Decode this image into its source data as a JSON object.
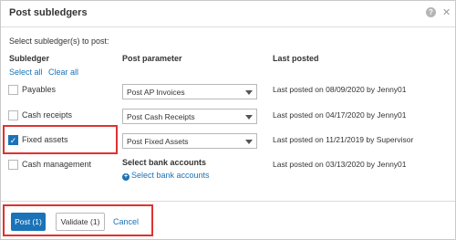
{
  "dialog": {
    "title": "Post subledgers",
    "help_icon": "question-icon",
    "close_icon": "close-icon"
  },
  "instruction": "Select subledger(s) to post:",
  "columns": {
    "subledger": "Subledger",
    "post_parameter": "Post parameter",
    "last_posted": "Last posted"
  },
  "links": {
    "select_all": "Select all",
    "clear_all": "Clear all"
  },
  "rows": [
    {
      "label": "Payables",
      "checked": false,
      "parameter": "Post AP Invoices",
      "last_posted": "Last posted on 08/09/2020 by Jenny01"
    },
    {
      "label": "Cash receipts",
      "checked": false,
      "parameter": "Post Cash Receipts",
      "last_posted": "Last posted on 04/17/2020 by Jenny01"
    },
    {
      "label": "Fixed assets",
      "checked": true,
      "parameter": "Post Fixed Assets",
      "last_posted": "Last posted on 11/21/2019 by Supervisor"
    },
    {
      "label": "Cash management",
      "checked": false,
      "last_posted": "Last posted on 03/13/2020 by Jenny01"
    }
  ],
  "bank": {
    "title": "Select bank accounts",
    "link": "Select bank accounts"
  },
  "footer": {
    "post_label": "Post (1)",
    "validate_label": "Validate (1)",
    "cancel_label": "Cancel"
  },
  "colors": {
    "accent": "#1a73b8",
    "highlight": "#e03131"
  }
}
